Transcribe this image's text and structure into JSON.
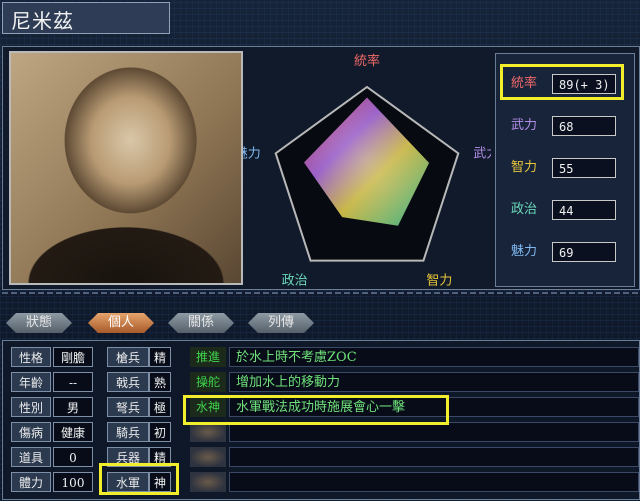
{
  "window": {
    "title": "尼米茲"
  },
  "radar": {
    "labels": [
      "統率",
      "武力",
      "智力",
      "政治",
      "魅力"
    ],
    "values": [
      89,
      68,
      55,
      44,
      69
    ],
    "max": 100
  },
  "stats": [
    {
      "label": "統率",
      "value": "89(+ 3)",
      "color": "#f06a6a"
    },
    {
      "label": "武力",
      "value": "68",
      "color": "#b38ee8"
    },
    {
      "label": "智力",
      "value": "55",
      "color": "#e8c63a"
    },
    {
      "label": "政治",
      "value": "44",
      "color": "#6ad6b8"
    },
    {
      "label": "魅力",
      "value": "69",
      "color": "#7fb8f0"
    }
  ],
  "tabs": [
    {
      "label": "狀態",
      "active": false
    },
    {
      "label": "個人",
      "active": true
    },
    {
      "label": "關係",
      "active": false
    },
    {
      "label": "列傳",
      "active": false
    }
  ],
  "personal": [
    {
      "label": "性格",
      "value": "剛膽"
    },
    {
      "label": "年齡",
      "value": "--"
    },
    {
      "label": "性別",
      "value": "男"
    },
    {
      "label": "傷病",
      "value": "健康"
    },
    {
      "label": "道具",
      "value": "0"
    },
    {
      "label": "體力",
      "value": "100"
    }
  ],
  "aptitudes": [
    {
      "label": "槍兵",
      "value": "精"
    },
    {
      "label": "戟兵",
      "value": "熟"
    },
    {
      "label": "弩兵",
      "value": "極"
    },
    {
      "label": "騎兵",
      "value": "初"
    },
    {
      "label": "兵器",
      "value": "精"
    },
    {
      "label": "水軍",
      "value": "神"
    }
  ],
  "skills": [
    {
      "name": "推進",
      "desc": "於水上時不考慮ZOC"
    },
    {
      "name": "操舵",
      "desc": "增加水上的移動力"
    },
    {
      "name": "水神",
      "desc": "水軍戰法成功時施展會心一擊"
    },
    {
      "name": "",
      "desc": ""
    },
    {
      "name": "",
      "desc": ""
    },
    {
      "name": "",
      "desc": ""
    }
  ],
  "highlight_color": "#f2ee2c"
}
